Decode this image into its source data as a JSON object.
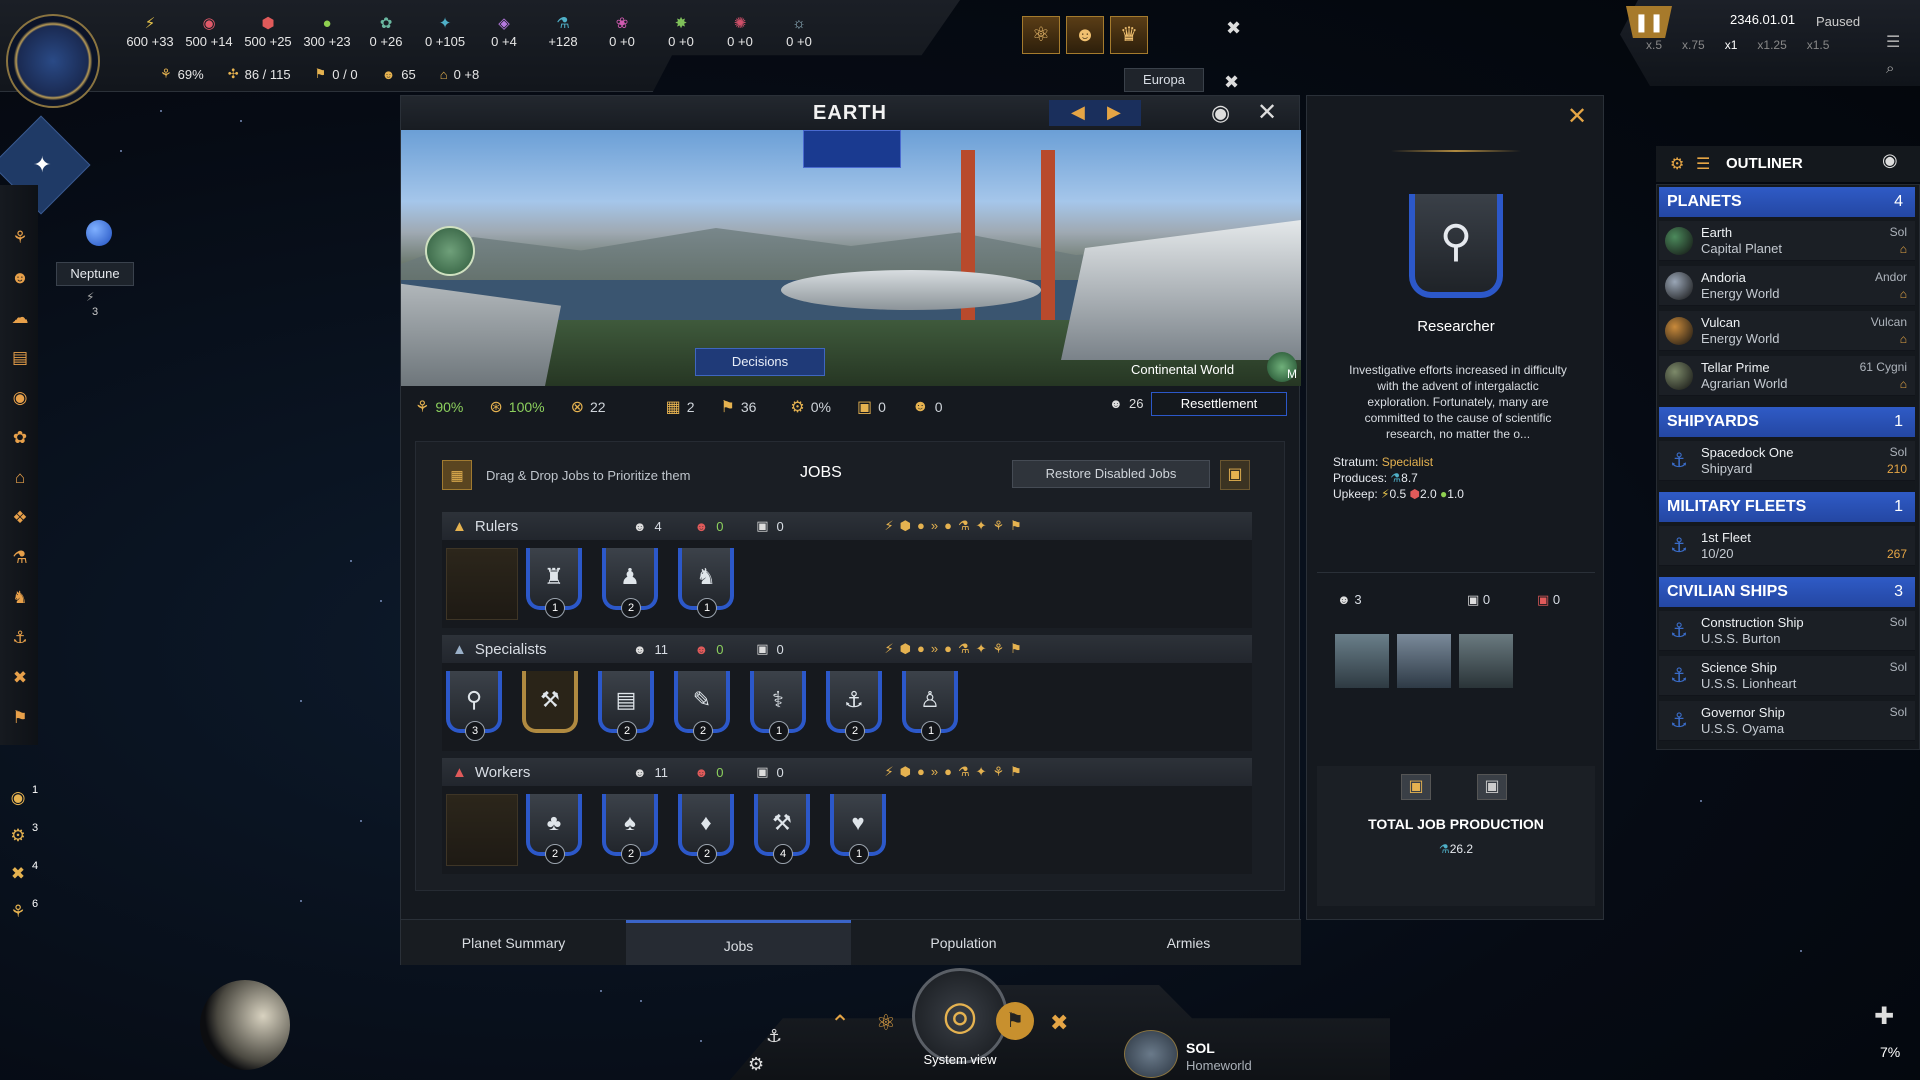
{
  "resources": [
    {
      "icon": "energy-icon",
      "glyph": "⚡",
      "value": "600 +33",
      "color": "#e5c24b"
    },
    {
      "icon": "minerals-icon",
      "glyph": "◉",
      "value": "500 +14",
      "color": "#e05a6a"
    },
    {
      "icon": "alloys-icon",
      "glyph": "⬢",
      "value": "500 +25",
      "color": "#e05a5a"
    },
    {
      "icon": "food-icon",
      "glyph": "●",
      "value": "300 +23",
      "color": "#8fd050"
    },
    {
      "icon": "consumer-goods-icon",
      "glyph": "✿",
      "value": "0 +26",
      "color": "#6ab7a0"
    },
    {
      "icon": "research-physics-icon",
      "glyph": "✦",
      "value": "0 +105",
      "color": "#4fb0c8"
    },
    {
      "icon": "influence-icon",
      "glyph": "◈",
      "value": "0 +4",
      "color": "#b67ae0"
    },
    {
      "icon": "unity-icon",
      "glyph": "⚗",
      "value": "+128",
      "color": "#4fb0c8"
    },
    {
      "icon": "exotic-gases-icon",
      "glyph": "❀",
      "value": "0 +0",
      "color": "#d05ab0"
    },
    {
      "icon": "rare-crystals-icon",
      "glyph": "✸",
      "value": "0 +0",
      "color": "#7fc05a"
    },
    {
      "icon": "volatile-motes-icon",
      "glyph": "✺",
      "value": "0 +0",
      "color": "#d0506a"
    },
    {
      "icon": "dark-matter-icon",
      "glyph": "☼",
      "value": "0 +0",
      "color": "#9cc0d0"
    }
  ],
  "secondary": [
    {
      "icon": "stability-icon",
      "glyph": "⚘",
      "value": "69%"
    },
    {
      "icon": "empire-size-icon",
      "glyph": "✣",
      "value": "86 / 115"
    },
    {
      "icon": "amenities-icon",
      "glyph": "⚑",
      "value": "0 / 0"
    },
    {
      "icon": "pops-icon",
      "glyph": "☻",
      "value": "65"
    },
    {
      "icon": "trade-icon",
      "glyph": "⌂",
      "value": "0 +8"
    }
  ],
  "date": {
    "value": "2346.01.01",
    "status": "Paused",
    "speeds": [
      "x.5",
      "x.75",
      "x1",
      "x1.25",
      "x1.5"
    ]
  },
  "europa_label": "Europa",
  "neptune": {
    "name": "Neptune",
    "count": "3"
  },
  "panel": {
    "title": "EARTH",
    "decisions": "Decisions",
    "planet_class": "Continental World",
    "size_badge": "M",
    "stats": [
      {
        "icon": "stability-icon",
        "glyph": "⚘",
        "value": "90%",
        "green": true
      },
      {
        "icon": "crime-icon",
        "glyph": "⊛",
        "value": "100%",
        "green": true
      },
      {
        "icon": "devastation-icon",
        "glyph": "⊗",
        "value": "22",
        "green": false
      },
      {
        "icon": "districts-icon",
        "glyph": "▦",
        "value": "2",
        "green": false
      },
      {
        "icon": "housing-icon",
        "glyph": "⚑",
        "value": "36",
        "green": false
      },
      {
        "icon": "amenities-icon",
        "glyph": "⚙",
        "value": "0%",
        "green": false
      },
      {
        "icon": "buildings-icon",
        "glyph": "▣",
        "value": "0",
        "green": false
      },
      {
        "icon": "unemployed-icon",
        "glyph": "☻",
        "value": "0",
        "green": false
      }
    ],
    "pops_total": "26",
    "resettlement": "Resettlement",
    "jobs_hint": "Drag & Drop Jobs to Prioritize them",
    "jobs_title": "JOBS",
    "restore_btn": "Restore Disabled Jobs",
    "strata": [
      {
        "name": "Rulers",
        "pops": "4",
        "unemployed": "0",
        "free": "0",
        "jobs": [
          {
            "glyph": "♜",
            "n": "1"
          },
          {
            "glyph": "♟",
            "n": "2"
          },
          {
            "glyph": "♞",
            "n": "1"
          }
        ]
      },
      {
        "name": "Specialists",
        "pops": "11",
        "unemployed": "0",
        "free": "0",
        "jobs": [
          {
            "glyph": "⚲",
            "n": "3"
          },
          {
            "glyph": "⚒",
            "n": ""
          },
          {
            "glyph": "▤",
            "n": "2"
          },
          {
            "glyph": "✎",
            "n": "2"
          },
          {
            "glyph": "⚕",
            "n": "1"
          },
          {
            "glyph": "⚓",
            "n": "2"
          },
          {
            "glyph": "♙",
            "n": "1"
          }
        ]
      },
      {
        "name": "Workers",
        "pops": "11",
        "unemployed": "0",
        "free": "0",
        "jobs": [
          {
            "glyph": "♣",
            "n": "2"
          },
          {
            "glyph": "♠",
            "n": "2"
          },
          {
            "glyph": "♦",
            "n": "2"
          },
          {
            "glyph": "⚒",
            "n": "4"
          },
          {
            "glyph": "♥",
            "n": "1"
          }
        ]
      }
    ],
    "tabs": [
      "Planet Summary",
      "Jobs",
      "Population",
      "Armies"
    ],
    "active_tab": 1
  },
  "detail": {
    "job_name": "Researcher",
    "description": "Investigative efforts increased in difficulty with the advent of intergalactic exploration. Fortunately, many are committed to the cause of scientific research, no matter the o...",
    "stratum_label": "Stratum:",
    "stratum_value": "Specialist",
    "produces_label": "Produces:",
    "produces_value": "8.7",
    "upkeep_label": "Upkeep:",
    "upkeep_values": [
      "0.5",
      "2.0",
      "1.0"
    ],
    "pops": "3",
    "free": "0",
    "disabled": "0",
    "total_label": "TOTAL JOB PRODUCTION",
    "total_value": "26.2"
  },
  "outliner": {
    "title": "OUTLINER",
    "sections": [
      {
        "name": "PLANETS",
        "count": "4",
        "rows": [
          {
            "t1": "Earth",
            "t2": "Capital Planet",
            "r1": "Sol",
            "r2": "⌂",
            "color": "#4c8a5c"
          },
          {
            "t1": "Andoria",
            "t2": "Energy World",
            "r1": "Andor",
            "r2": "⌂",
            "color": "#9aa6b6"
          },
          {
            "t1": "Vulcan",
            "t2": "Energy World",
            "r1": "Vulcan",
            "r2": "⌂",
            "color": "#c98a3b"
          },
          {
            "t1": "Tellar Prime",
            "t2": "Agrarian World",
            "r1": "61 Cygni",
            "r2": "⌂",
            "color": "#7d8a6a"
          }
        ]
      },
      {
        "name": "SHIPYARDS",
        "count": "1",
        "rows": [
          {
            "t1": "Spacedock One",
            "t2": "Shipyard",
            "r1": "Sol",
            "r2": "210",
            "color": "#3a6cc8"
          }
        ]
      },
      {
        "name": "MILITARY FLEETS",
        "count": "1",
        "rows": [
          {
            "t1": "1st Fleet",
            "t2": "10/20",
            "r1": "",
            "r2": "267",
            "color": "#3a6cc8"
          }
        ]
      },
      {
        "name": "CIVILIAN SHIPS",
        "count": "3",
        "rows": [
          {
            "t1": "Construction Ship",
            "t2": "U.S.S. Burton",
            "r1": "Sol",
            "r2": "",
            "color": "#3a6cc8"
          },
          {
            "t1": "Science Ship",
            "t2": "U.S.S. Lionheart",
            "r1": "Sol",
            "r2": "",
            "color": "#3a6cc8"
          },
          {
            "t1": "Governor Ship",
            "t2": "U.S.S. Oyama",
            "r1": "Sol",
            "r2": "",
            "color": "#3a6cc8"
          }
        ]
      }
    ]
  },
  "bottom": {
    "system_view": "System view",
    "system_name": "SOL",
    "system_sub": "Homeworld",
    "left_counts": [
      "1",
      "3",
      "4",
      "6"
    ],
    "zoom_pct": "7%"
  }
}
